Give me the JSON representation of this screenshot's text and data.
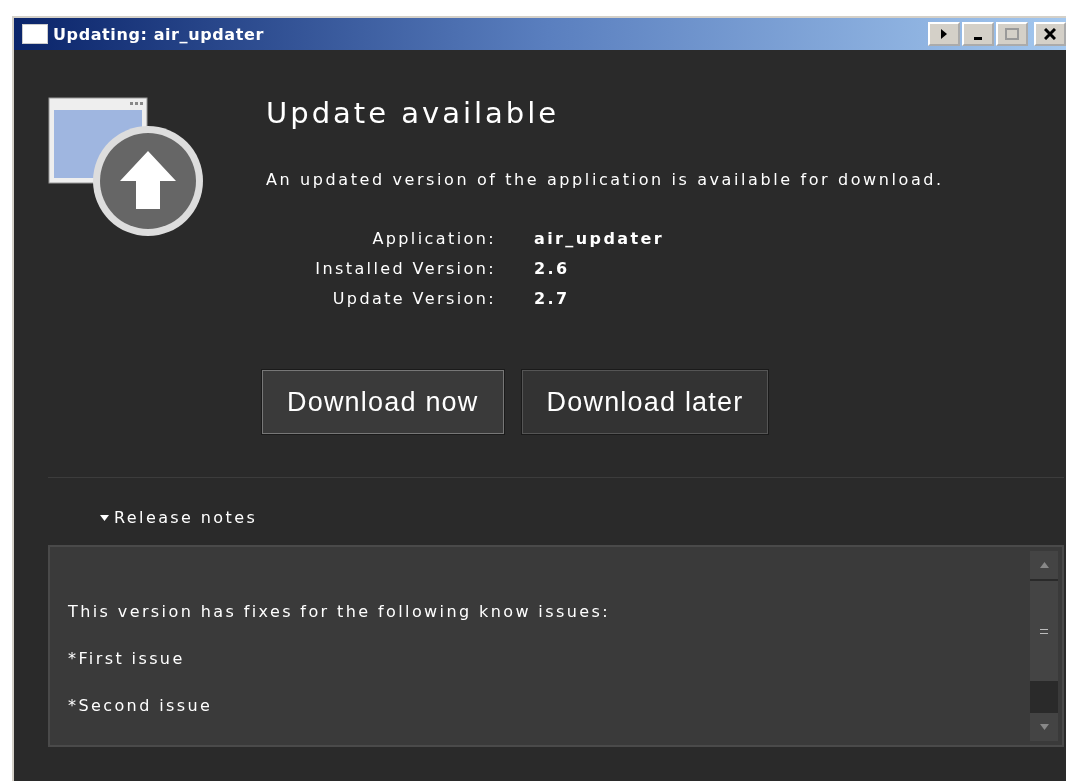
{
  "window": {
    "title": "Updating: air_updater"
  },
  "heading": "Update available",
  "description": "An updated version of the application is available for download.",
  "details": [
    {
      "label": "Application:",
      "value": "air_updater"
    },
    {
      "label": "Installed Version:",
      "value": "2.6"
    },
    {
      "label": "Update Version:",
      "value": "2.7"
    }
  ],
  "buttons": [
    {
      "label": "Download now",
      "selected": true
    },
    {
      "label": "Download later",
      "selected": false
    }
  ],
  "release_notes": {
    "label": "Release notes",
    "expanded": true,
    "lines": [
      "This version has fixes for the following know issues:",
      "*First issue",
      "*Second issue"
    ]
  }
}
